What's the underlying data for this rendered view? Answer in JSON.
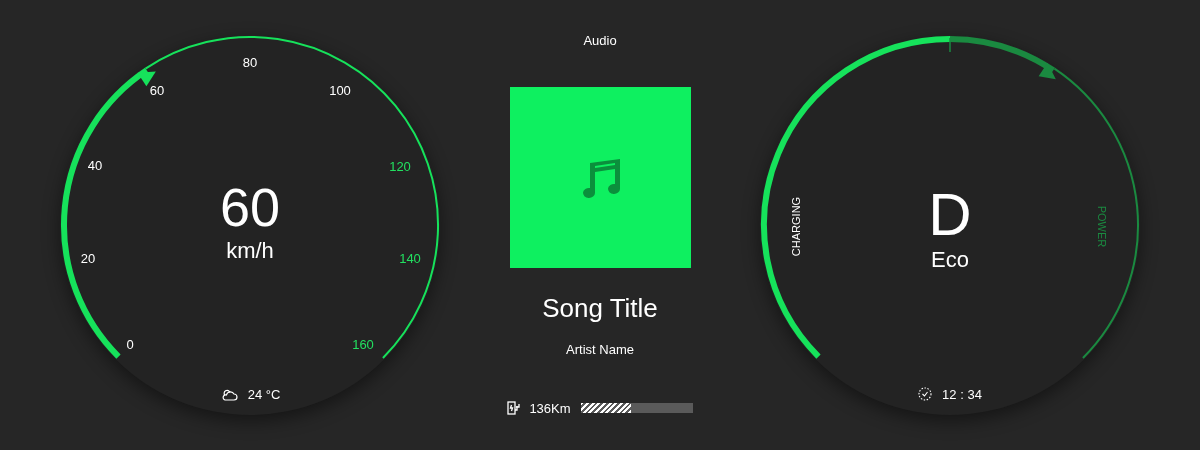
{
  "speedometer": {
    "speed": "60",
    "unit": "km/h",
    "ticks": [
      {
        "label": "0",
        "color": "#ffffff"
      },
      {
        "label": "20",
        "color": "#ffffff"
      },
      {
        "label": "40",
        "color": "#ffffff"
      },
      {
        "label": "60",
        "color": "#ffffff"
      },
      {
        "label": "80",
        "color": "#ffffff"
      },
      {
        "label": "100",
        "color": "#ffffff"
      },
      {
        "label": "120",
        "color": "#22e060"
      },
      {
        "label": "140",
        "color": "#22e060"
      },
      {
        "label": "160",
        "color": "#22e060"
      }
    ],
    "temperature": "24 °C"
  },
  "media": {
    "title": "Audio",
    "song": "Song Title",
    "artist": "Artist Name",
    "range": {
      "text": "136Km",
      "level": 0.45
    }
  },
  "drive": {
    "gear": "D",
    "mode": "Eco",
    "charging": {
      "label": "CHARGING"
    },
    "power": {
      "label": "POWER"
    },
    "time": "12 : 34"
  }
}
